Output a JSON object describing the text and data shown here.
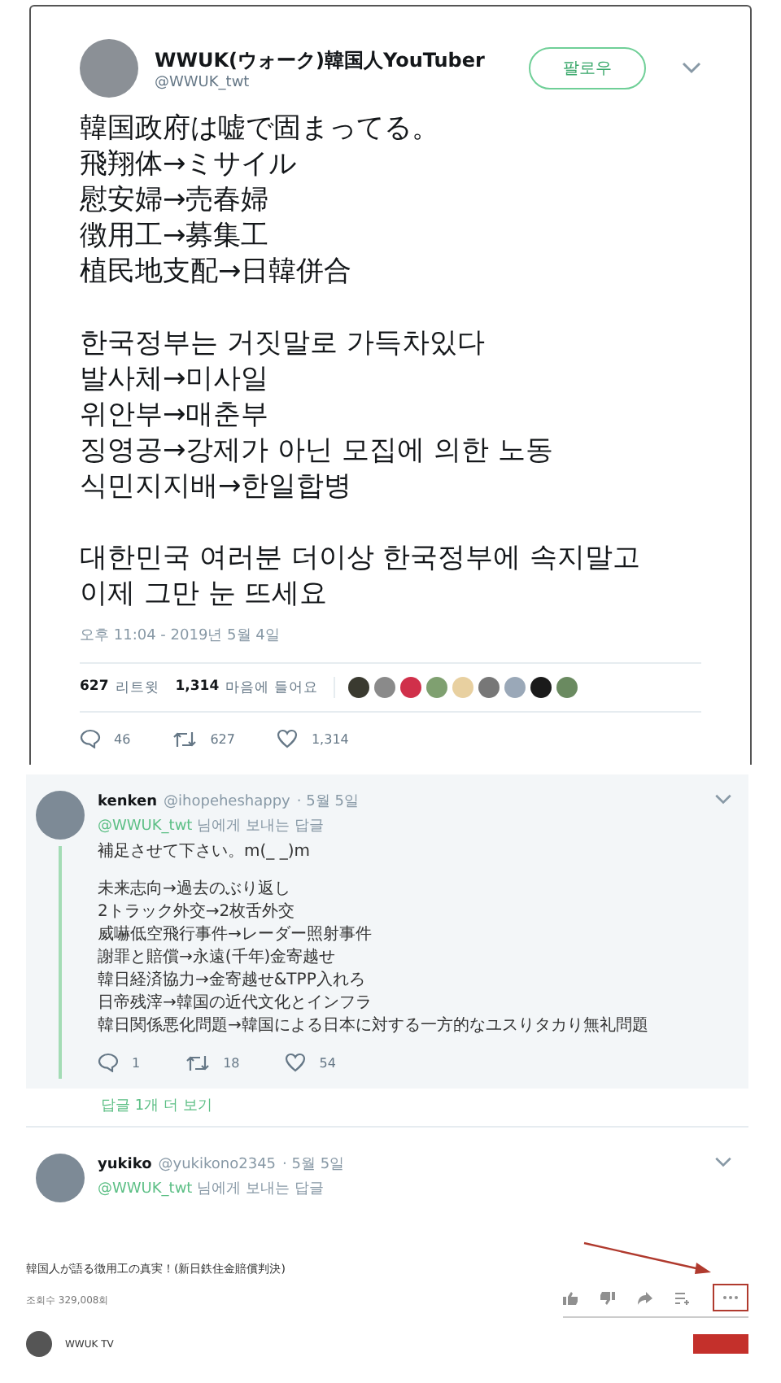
{
  "tweet": {
    "name": "WWUK(ウォーク)韓国人YouTuber",
    "handle": "@WWUK_twt",
    "follow_button": "팔로우",
    "paragraphs": [
      [
        "韓国政府は嘘で固まってる。",
        "飛翔体→ミサイル",
        "慰安婦→売春婦",
        "徴用工→募集工",
        "植民地支配→日韓併合"
      ],
      [
        "한국정부는 거짓말로 가득차있다",
        "발사체→미사일",
        "위안부→매춘부",
        "징영공→강제가 아닌 모집에 의한 노동",
        "식민지지배→한일합병"
      ],
      [
        "대한민국 여러분 더이상 한국정부에 속지말고",
        "이제 그만 눈 뜨세요"
      ]
    ],
    "timestamp": "오후 11:04 - 2019년 5월 4일",
    "retweet_count": "627",
    "retweet_label": "리트윗",
    "like_count": "1,314",
    "like_label": "마음에 들어요",
    "actions": {
      "replies": "46",
      "retweets": "627",
      "likes": "1,314"
    }
  },
  "replies": [
    {
      "name": "kenken",
      "handle": "@ihopeheshappy",
      "date": "· 5월 5일",
      "reply_to": "@WWUK_twt",
      "reply_to_suffix": "님에게 보내는 답글",
      "paragraphs": [
        [
          "補足させて下さい。m(_ _)m"
        ],
        [
          "未来志向→過去のぶり返し",
          "2トラック外交→2枚舌外交",
          "威嚇低空飛行事件→レーダー照射事件",
          "謝罪と賠償→永遠(千年)金寄越せ",
          "韓日経済協力→金寄越せ&TPP入れろ",
          "日帝残滓→韓国の近代文化とインフラ",
          "韓日関係悪化問題→韓国による日本に対する一方的なユスりタカり無礼問題"
        ]
      ],
      "actions": {
        "replies": "1",
        "retweets": "18",
        "likes": "54"
      },
      "more_replies": "답글 1개 더 보기"
    },
    {
      "name": "yukiko",
      "handle": "@yukikono2345",
      "date": "· 5월 5일",
      "reply_to": "@WWUK_twt",
      "reply_to_suffix": "님에게 보내는 답글"
    }
  ],
  "video": {
    "title": "韓国人が語る徴用工の真実！(新日鉄住金賠償判決)",
    "views": "조회수 329,008회",
    "channel": "WWUK TV"
  }
}
